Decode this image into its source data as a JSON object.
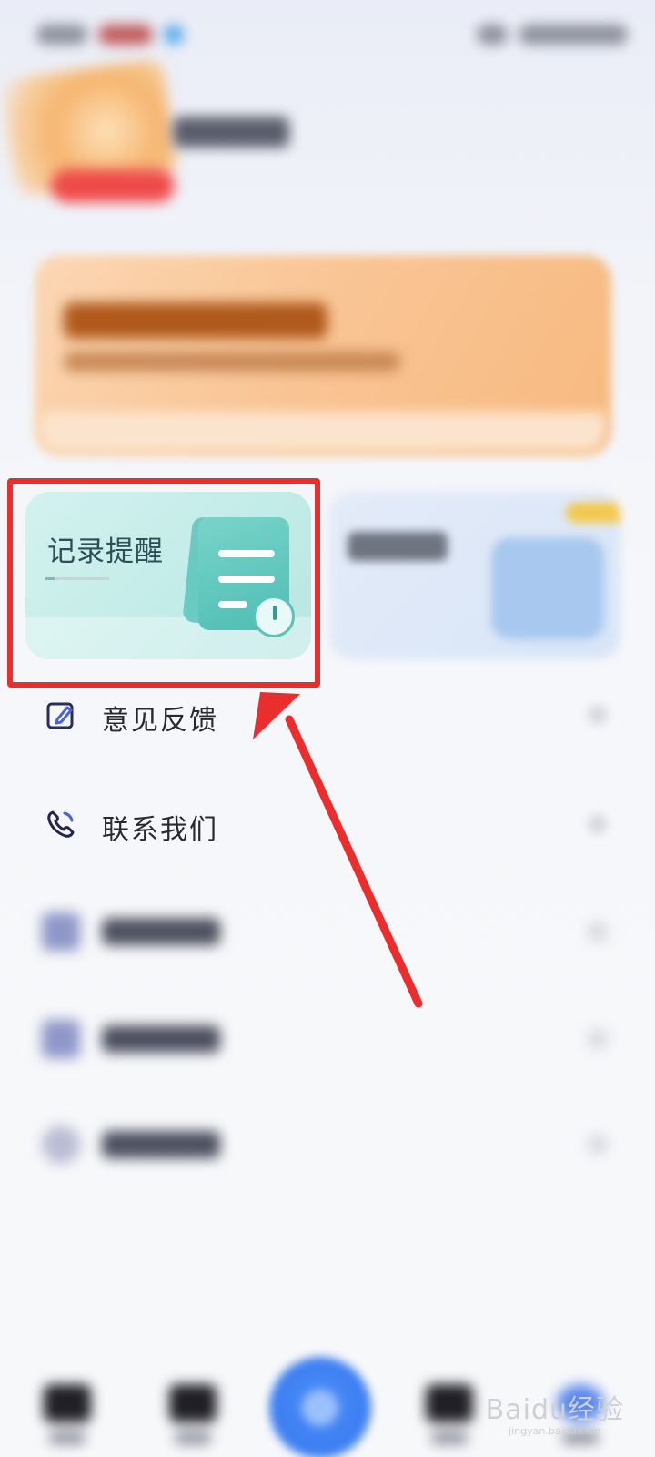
{
  "cards": {
    "remind": {
      "title": "记录提醒"
    }
  },
  "menu": [
    {
      "label": "意见反馈",
      "icon": "edit-icon"
    },
    {
      "label": "联系我们",
      "icon": "phone-icon"
    },
    {
      "icon": "document-icon"
    },
    {
      "icon": "shield-icon"
    },
    {
      "icon": "info-icon"
    }
  ],
  "highlight_color": "#ea2d2d",
  "watermark": {
    "text": "Baidu经验",
    "sub": "jingyan.baidu.com"
  }
}
